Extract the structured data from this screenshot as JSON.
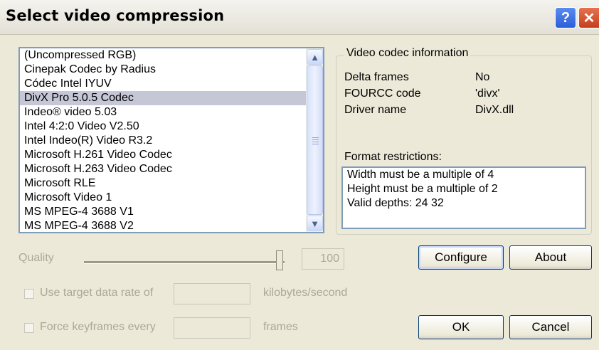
{
  "window": {
    "title": "Select video compression",
    "help_glyph": "?",
    "close_glyph": "✕"
  },
  "codec_list": {
    "items": [
      "(Uncompressed RGB)",
      "Cinepak Codec by Radius",
      "Códec Intel IYUV",
      "DivX Pro 5.0.5 Codec",
      "Indeo® video 5.03",
      "Intel 4:2:0 Video V2.50",
      "Intel Indeo(R) Video R3.2",
      "Microsoft H.261 Video Codec",
      "Microsoft H.263 Video Codec",
      "Microsoft RLE",
      "Microsoft Video 1",
      "MS MPEG-4 3688 V1",
      "MS MPEG-4 3688 V2"
    ],
    "selected": "DivX Pro 5.0.5 Codec",
    "scroll_up_glyph": "▲",
    "scroll_down_glyph": "▼"
  },
  "codec_info": {
    "legend": "Video codec information",
    "rows": [
      {
        "label": "Delta frames",
        "value": "No"
      },
      {
        "label": "FOURCC code",
        "value": "'divx'"
      },
      {
        "label": "Driver name",
        "value": "DivX.dll"
      }
    ],
    "restrictions_label": "Format restrictions:",
    "restrictions": [
      "Width must be a multiple of 4",
      "Height must be a multiple of 2",
      "Valid depths: 24 32"
    ]
  },
  "quality": {
    "label": "Quality",
    "value": "100"
  },
  "buttons": {
    "configure": "Configure",
    "about": "About",
    "ok": "OK",
    "cancel": "Cancel"
  },
  "data_rate": {
    "label": "Use target data rate of",
    "unit": "kilobytes/second",
    "checked": false
  },
  "keyframes": {
    "label": "Force keyframes every",
    "unit": "frames",
    "checked": false
  },
  "colors": {
    "window_bg": "#ece9d8",
    "selection": "#c6c7d6",
    "disabled_text": "#aca899",
    "field_border": "#7f9db9"
  }
}
